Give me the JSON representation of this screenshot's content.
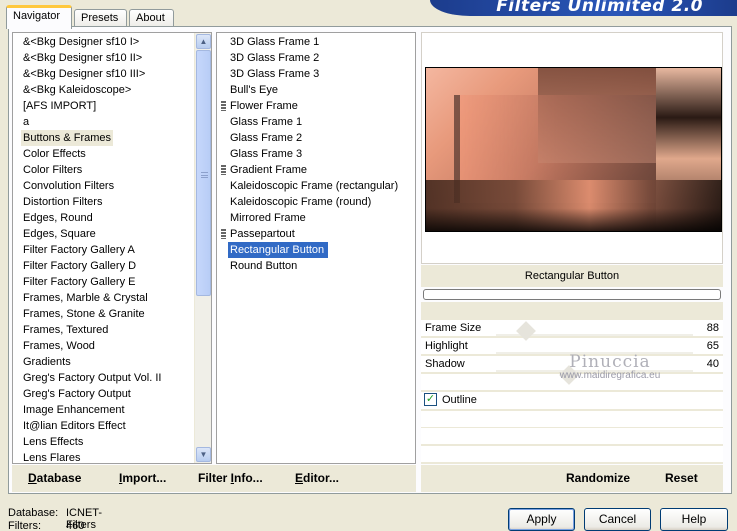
{
  "tabs": [
    "Navigator",
    "Presets",
    "About"
  ],
  "banner_title": "Filters Unlimited 2.0",
  "categories": [
    "&<Bkg Designer sf10 I>",
    "&<Bkg Designer sf10 II>",
    "&<Bkg Designer sf10 III>",
    "&<Bkg Kaleidoscope>",
    "[AFS IMPORT]",
    "a",
    "Buttons & Frames",
    "Color Effects",
    "Color Filters",
    "Convolution Filters",
    "Distortion Filters",
    "Edges, Round",
    "Edges, Square",
    "Filter Factory Gallery A",
    "Filter Factory Gallery D",
    "Filter Factory Gallery E",
    "Frames, Marble & Crystal",
    "Frames, Stone & Granite",
    "Frames, Textured",
    "Frames, Wood",
    "Gradients",
    "Greg's Factory Output Vol. II",
    "Greg's Factory Output",
    "Image Enhancement",
    "It@lian Editors Effect",
    "Lens Effects",
    "Lens Flares"
  ],
  "selected_category": "Buttons & Frames",
  "filters": [
    {
      "label": "3D Glass Frame 1",
      "marker": false
    },
    {
      "label": "3D Glass Frame 2",
      "marker": false
    },
    {
      "label": "3D Glass Frame 3",
      "marker": false
    },
    {
      "label": "Bull's Eye",
      "marker": false
    },
    {
      "label": "Flower Frame",
      "marker": true
    },
    {
      "label": "Glass Frame 1",
      "marker": false
    },
    {
      "label": "Glass Frame 2",
      "marker": false
    },
    {
      "label": "Glass Frame 3",
      "marker": false
    },
    {
      "label": "Gradient Frame",
      "marker": true
    },
    {
      "label": "Kaleidoscopic Frame (rectangular)",
      "marker": false
    },
    {
      "label": "Kaleidoscopic Frame (round)",
      "marker": false
    },
    {
      "label": "Mirrored Frame",
      "marker": false
    },
    {
      "label": "Passepartout",
      "marker": true
    },
    {
      "label": "Rectangular Button",
      "marker": false
    },
    {
      "label": "Round Button",
      "marker": false
    }
  ],
  "selected_filter": "Rectangular Button",
  "current_filter_name": "Rectangular Button",
  "params": [
    {
      "label": "Frame Size",
      "value": "88"
    },
    {
      "label": "Highlight",
      "value": "65"
    },
    {
      "label": "Shadow",
      "value": "40"
    }
  ],
  "outline": {
    "label": "Outline",
    "checked": true,
    "mark": "✓"
  },
  "watermark": {
    "name": "Pinuccia",
    "url": "www.maidiregrafica.eu"
  },
  "toolbar": {
    "database": {
      "u": "D",
      "rest": "atabase"
    },
    "import": {
      "u": "I",
      "rest": "mport..."
    },
    "filter_info": {
      "pre": "Filter ",
      "u": "I",
      "rest": "nfo..."
    },
    "editor": {
      "u": "E",
      "rest": "ditor..."
    },
    "randomize": "Randomize",
    "reset": "Reset"
  },
  "status": {
    "database_label": "Database:",
    "database_value": "ICNET-Filters",
    "filters_label": "Filters:",
    "filters_value": "460"
  },
  "buttons": {
    "apply": "Apply",
    "cancel": "Cancel",
    "help": "Help"
  },
  "colors": {
    "selection": "#316ac5",
    "tab_highlight": "#ffc83c",
    "banner": "#2a56b8"
  }
}
